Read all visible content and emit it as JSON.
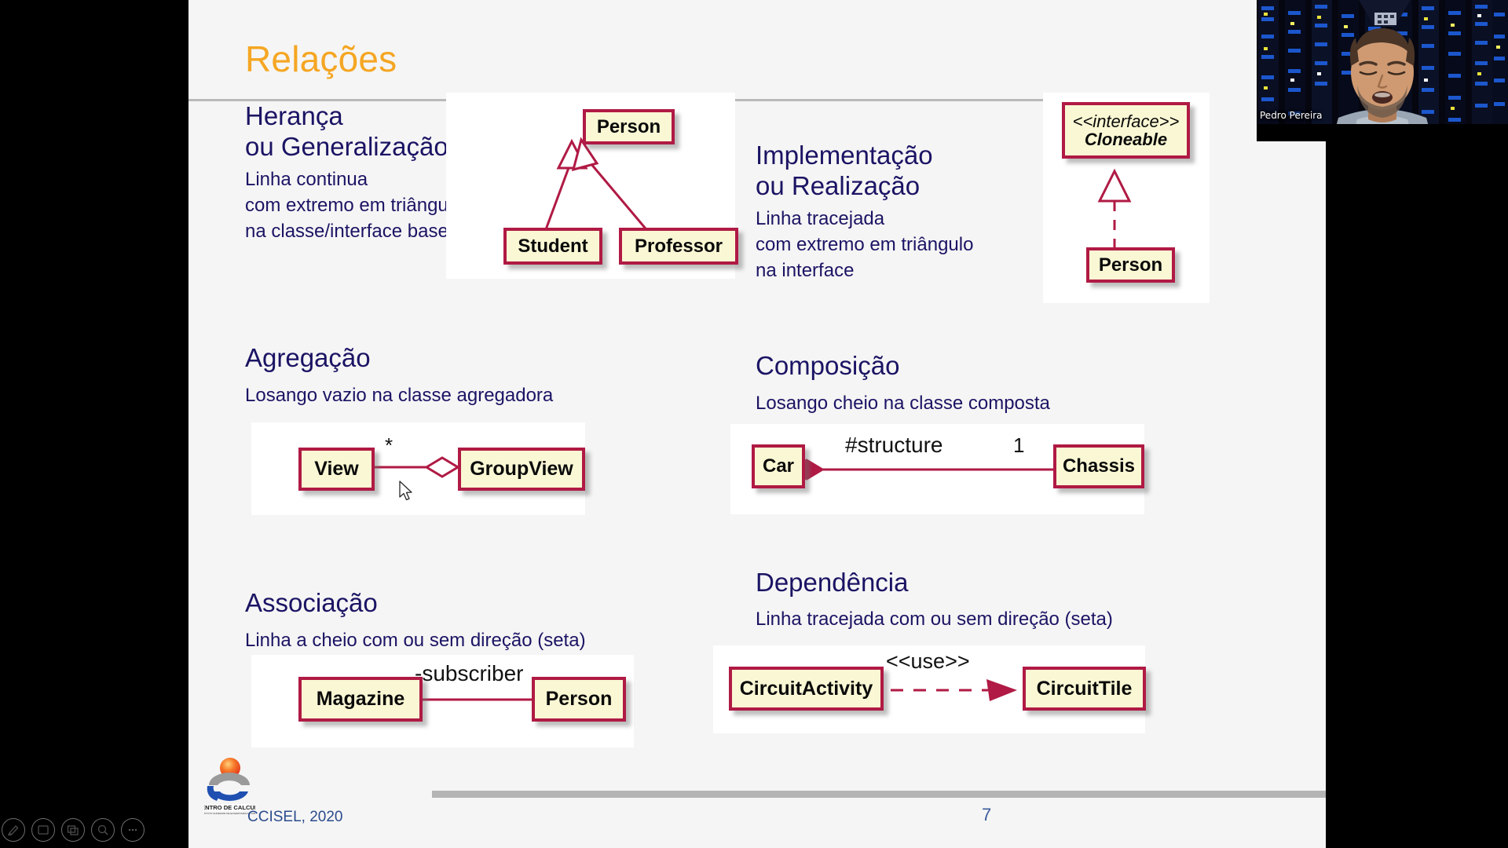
{
  "slide": {
    "title": "Relações",
    "footer_text": "CCISEL, 2020",
    "page_number": "7",
    "logo_caption": "CENTRO DE CALCULO",
    "logo_subcaption": "INSTITUTO SUPERIOR DE ENGENHARIA DE LISBOA"
  },
  "sections": [
    {
      "id": "heranca",
      "heading": "Herança\nou Generalização",
      "description": "Linha continua\ncom extremo em triângulo\nna classe/interface base",
      "diagram": {
        "type": "generalization",
        "boxes": [
          {
            "name": "Person"
          },
          {
            "name": "Student"
          },
          {
            "name": "Professor"
          }
        ]
      }
    },
    {
      "id": "implementacao",
      "heading": "Implementação\nou Realização",
      "description": "Linha tracejada\ncom extremo em triângulo\nna interface",
      "diagram": {
        "type": "realization",
        "boxes": [
          {
            "stereotype": "<<interface>>",
            "name": "Cloneable"
          },
          {
            "name": "Person"
          }
        ]
      }
    },
    {
      "id": "agregacao",
      "heading": "Agregação",
      "description": "Losango vazio na classe agregadora",
      "diagram": {
        "type": "aggregation",
        "boxes": [
          {
            "name": "View"
          },
          {
            "name": "GroupView"
          }
        ],
        "labels": [
          {
            "text": "*"
          }
        ]
      }
    },
    {
      "id": "composicao",
      "heading": "Composição",
      "description": "Losango cheio na classe composta",
      "diagram": {
        "type": "composition",
        "boxes": [
          {
            "name": "Car"
          },
          {
            "name": "Chassis"
          }
        ],
        "labels": [
          {
            "text": "#structure"
          },
          {
            "text": "1"
          }
        ]
      }
    },
    {
      "id": "associacao",
      "heading": "Associação",
      "description": "Linha a cheio com ou sem direção (seta)",
      "diagram": {
        "type": "association",
        "boxes": [
          {
            "name": "Magazine"
          },
          {
            "name": "Person"
          }
        ],
        "labels": [
          {
            "text": "-subscriber"
          }
        ]
      }
    },
    {
      "id": "dependencia",
      "heading": "Dependência",
      "description": "Linha tracejada com ou sem direção (seta)",
      "diagram": {
        "type": "dependency",
        "boxes": [
          {
            "name": "CircuitActivity"
          },
          {
            "name": "CircuitTile"
          }
        ],
        "labels": [
          {
            "text": "<<use>>"
          }
        ]
      }
    }
  ],
  "webcam": {
    "participant_name": "Pedro Pereira"
  },
  "presentation_controls": [
    {
      "name": "pen-icon"
    },
    {
      "name": "slide-navigation-icon"
    },
    {
      "name": "all-slides-icon"
    },
    {
      "name": "zoom-icon"
    },
    {
      "name": "more-options-icon"
    }
  ],
  "colors": {
    "title": "#f5a623",
    "heading": "#1b1464",
    "uml_border": "#b01a44",
    "uml_fill": "#faf8d4",
    "slide_bg": "#f5f5f5",
    "footer_link": "#2a4b8d"
  }
}
